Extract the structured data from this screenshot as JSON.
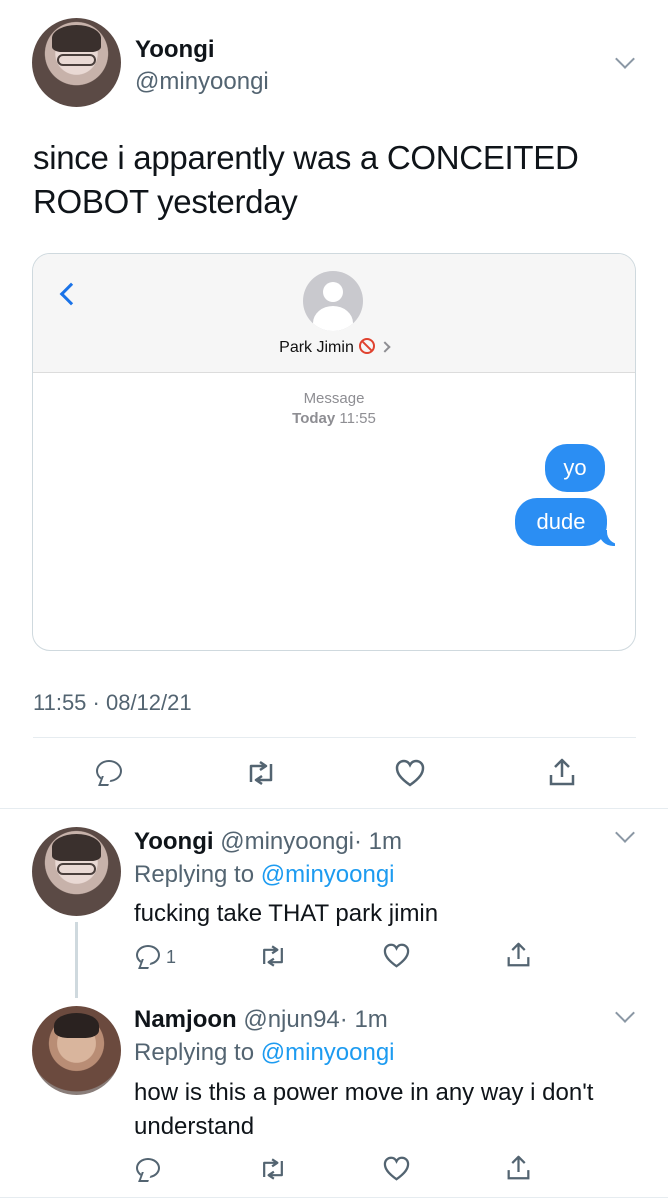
{
  "tweet": {
    "author_name": "Yoongi",
    "author_handle": "@minyoongi",
    "text_line1": "since i apparently was a CONCEITED",
    "text_line2": "ROBOT yesterday",
    "timestamp": "11:55 · 08/12/21",
    "avatar_icon": "avatar-photo-yoongi",
    "menu_icon": "chevron-down-icon"
  },
  "imessage": {
    "contact_name": "Park Jimin",
    "meta_label": "Message",
    "meta_day": "Today",
    "meta_time": "11:55",
    "bubbles": [
      "yo",
      "dude"
    ],
    "bubble_color": "#2b8ef3",
    "back_icon": "chevron-left-icon",
    "status_icon": "blocked-icon"
  },
  "actions": {
    "reply_icon": "reply-icon",
    "retweet_icon": "retweet-icon",
    "like_icon": "heart-icon",
    "share_icon": "share-icon"
  },
  "replies": [
    {
      "author_name": "Yoongi",
      "author_handle": "@minyoongi",
      "time": "· 1m",
      "replying_prefix": "Replying to",
      "replying_to": "@minyoongi",
      "text_line1": "fucking take THAT park jimin",
      "text_line2": "",
      "reply_count": "1"
    },
    {
      "author_name": "Namjoon",
      "author_handle": "@njun94",
      "time": "· 1m",
      "replying_prefix": "Replying to",
      "replying_to": "@minyoongi",
      "text_line1": "how is this a power move in any way i don't",
      "text_line2": "understand",
      "reply_count": ""
    }
  ],
  "colors": {
    "link": "#1d9bf0",
    "muted": "#536471",
    "text": "#0f1419"
  }
}
